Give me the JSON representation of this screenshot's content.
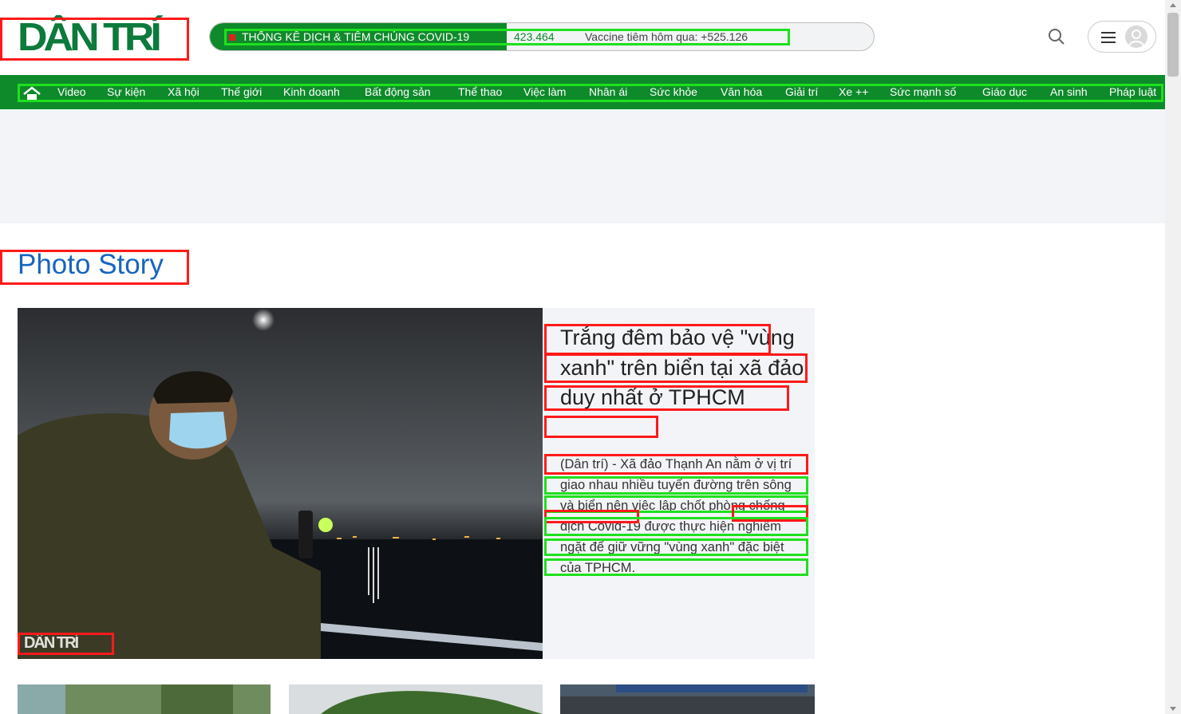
{
  "header": {
    "logo_text": "DÂN TRÍ",
    "covid_title": "THỐNG KÊ DỊCH & TIÊM CHỦNG COVID-19",
    "covid_count": "423.464",
    "vaccine_text": "Vaccine tiêm hôm qua: +525.126",
    "search_icon": "search-icon",
    "menu_icon": "hamburger-menu-icon",
    "avatar_icon": "user-avatar-icon"
  },
  "nav": {
    "home_icon": "home-icon",
    "items": [
      "Video",
      "Sự kiện",
      "Xã hội",
      "Thế giới",
      "Kinh doanh",
      "Bất động sản",
      "Thể thao",
      "Việc làm",
      "Nhân ái",
      "Sức khỏe",
      "Văn hóa",
      "Giải trí",
      "Xe ++",
      "Sức mạnh số",
      "Giáo dục",
      "An sinh",
      "Pháp luật"
    ]
  },
  "section": {
    "title": "Photo Story"
  },
  "hero": {
    "watermark": "DÂN TRÍ",
    "title": "Trắng đêm bảo vệ \"vùng xanh\" trên biển tại xã đảo duy nhất ở TPHCM",
    "sapo": "(Dân trí) - Xã đảo Thạnh An nằm ở vị trí giao nhau nhiều tuyến đường trên sông và biển nên việc lập chốt phòng chống dịch Covid-19 được thực hiện nghiêm ngặt để giữ vững \"vùng xanh\" đặc biệt của TPHCM."
  },
  "colors": {
    "brand_green": "#0e8a2a",
    "title_blue": "#1565c0",
    "annotation_red": "#ff1a1a",
    "annotation_green": "#1fe01f"
  }
}
